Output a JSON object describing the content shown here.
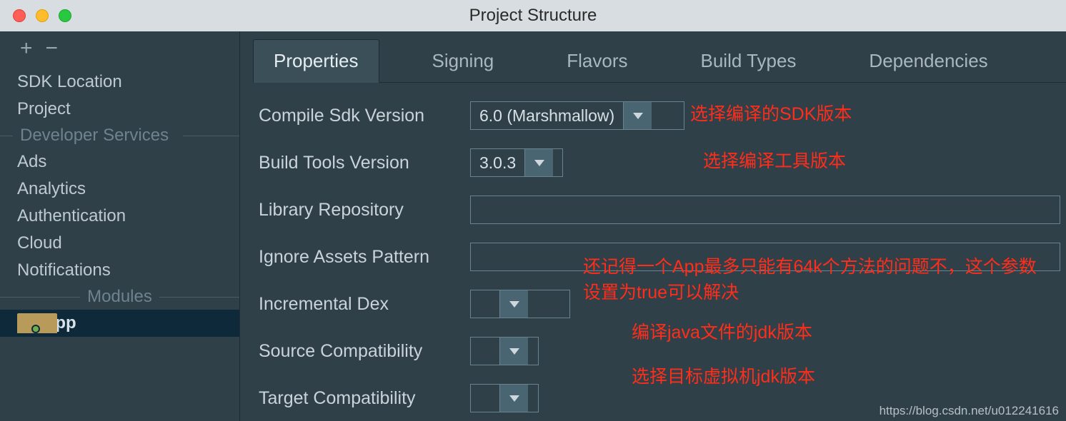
{
  "window": {
    "title": "Project Structure"
  },
  "sidebar": {
    "items": [
      {
        "label": "SDK Location"
      },
      {
        "label": "Project"
      }
    ],
    "dev_header": "Developer Services",
    "dev_items": [
      {
        "label": "Ads"
      },
      {
        "label": "Analytics"
      },
      {
        "label": "Authentication"
      },
      {
        "label": "Cloud"
      },
      {
        "label": "Notifications"
      }
    ],
    "mod_header": "Modules",
    "modules": [
      {
        "label": "app"
      }
    ]
  },
  "tabs": [
    {
      "label": "Properties",
      "active": true
    },
    {
      "label": "Signing"
    },
    {
      "label": "Flavors"
    },
    {
      "label": "Build Types"
    },
    {
      "label": "Dependencies"
    }
  ],
  "form": {
    "compile_sdk": {
      "label": "Compile Sdk Version",
      "value": "6.0 (Marshmallow)"
    },
    "build_tools": {
      "label": "Build Tools Version",
      "value": "3.0.3"
    },
    "lib_repo": {
      "label": "Library Repository",
      "value": ""
    },
    "ignore": {
      "label": "Ignore Assets Pattern",
      "value": ""
    },
    "inc_dex": {
      "label": "Incremental Dex",
      "value": ""
    },
    "src_compat": {
      "label": "Source Compatibility",
      "value": ""
    },
    "tgt_compat": {
      "label": "Target Compatibility",
      "value": ""
    }
  },
  "annotations": {
    "a1": "选择编译的SDK版本",
    "a2": "选择编译工具版本",
    "a3": "还记得一个App最多只能有64k个方法的问题不，这个参数设置为true可以解决",
    "a4": "编译java文件的jdk版本",
    "a5": "选择目标虚拟机jdk版本"
  },
  "watermark": "https://blog.csdn.net/u012241616"
}
